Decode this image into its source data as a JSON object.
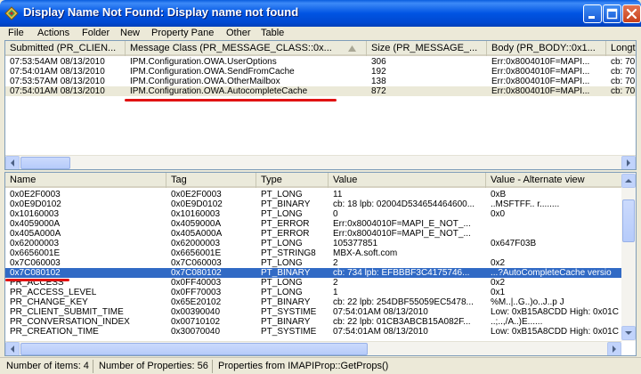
{
  "window": {
    "title": "Display Name Not Found: Display name not found"
  },
  "menu": [
    "File",
    "Actions",
    "Folder",
    "New",
    "Property Pane",
    "Other",
    "Table"
  ],
  "top_table": {
    "columns": [
      "Submitted (PR_CLIEN...",
      "Message Class (PR_MESSAGE_CLASS::0x...",
      "Size (PR_MESSAGE_...",
      "Body (PR_BODY::0x1...",
      "Longte"
    ],
    "rows": [
      [
        "07:53:54AM  08/13/2010",
        "IPM.Configuration.OWA.UserOptions",
        "306",
        "Err:0x8004010F=MAPI...",
        "cb: 70"
      ],
      [
        "07:54:01AM  08/13/2010",
        "IPM.Configuration.OWA.SendFromCache",
        "192",
        "Err:0x8004010F=MAPI...",
        "cb: 70"
      ],
      [
        "07:53:57AM  08/13/2010",
        "IPM.Configuration.OWA.OtherMailbox",
        "138",
        "Err:0x8004010F=MAPI...",
        "cb: 70"
      ],
      [
        "07:54:01AM  08/13/2010",
        "IPM.Configuration.OWA.AutocompleteCache",
        "872",
        "Err:0x8004010F=MAPI...",
        "cb: 70"
      ]
    ]
  },
  "bottom_table": {
    "columns": [
      "Name",
      "Tag",
      "Type",
      "Value",
      "Value - Alternate view"
    ],
    "rows": [
      [
        "0x0E2F0003",
        "0x0E2F0003",
        "PT_LONG",
        "11",
        "0xB"
      ],
      [
        "0x0E9D0102",
        "0x0E9D0102",
        "PT_BINARY",
        "cb: 18 lpb: 02004D534654464600...",
        "..MSFTFF.. r........"
      ],
      [
        "0x10160003",
        "0x10160003",
        "PT_LONG",
        "0",
        "0x0"
      ],
      [
        "0x4059000A",
        "0x4059000A",
        "PT_ERROR",
        "Err:0x8004010F=MAPI_E_NOT_...",
        ""
      ],
      [
        "0x405A000A",
        "0x405A000A",
        "PT_ERROR",
        "Err:0x8004010F=MAPI_E_NOT_...",
        ""
      ],
      [
        "0x62000003",
        "0x62000003",
        "PT_LONG",
        "105377851",
        "0x647F03B"
      ],
      [
        "0x6656001E",
        "0x6656001E",
        "PT_STRING8",
        "MBX-A.soft.com",
        ""
      ],
      [
        "0x7C060003",
        "0x7C060003",
        "PT_LONG",
        "2",
        "0x2"
      ],
      [
        "0x7C080102",
        "0x7C080102",
        "PT_BINARY",
        "cb: 734 lpb: EFBBBF3C4175746...",
        "...?AutoCompleteCache versio"
      ],
      [
        "PR_ACCESS",
        "0x0FF40003",
        "PT_LONG",
        "2",
        "0x2"
      ],
      [
        "PR_ACCESS_LEVEL",
        "0x0FF70003",
        "PT_LONG",
        "1",
        "0x1"
      ],
      [
        "PR_CHANGE_KEY",
        "0x65E20102",
        "PT_BINARY",
        "cb: 22 lpb: 254DBF55059EC5478...",
        "%M..|..G..)o..J..p  J"
      ],
      [
        "PR_CLIENT_SUBMIT_TIME",
        "0x00390040",
        "PT_SYSTIME",
        "07:54:01AM  08/13/2010",
        "Low: 0xB15A8CDD High: 0x01C"
      ],
      [
        "PR_CONVERSATION_INDEX",
        "0x00710102",
        "PT_BINARY",
        "cb: 22 lpb: 01CB3ABCB15A082F...",
        "..;..,/A..)E......"
      ],
      [
        "PR_CREATION_TIME",
        "0x30070040",
        "PT_SYSTIME",
        "07:54:01AM  08/13/2010",
        "Low: 0xB15A8CDD High: 0x01C"
      ]
    ]
  },
  "status": {
    "items": "Number of items: 4",
    "properties": "Number of Properties: 56",
    "source": "Properties from IMAPIProp::GetProps()"
  },
  "colors": {
    "selection_blue": "#316ac5",
    "annotation_red": "#e11212",
    "titlebar_blue": "#0054e3"
  }
}
